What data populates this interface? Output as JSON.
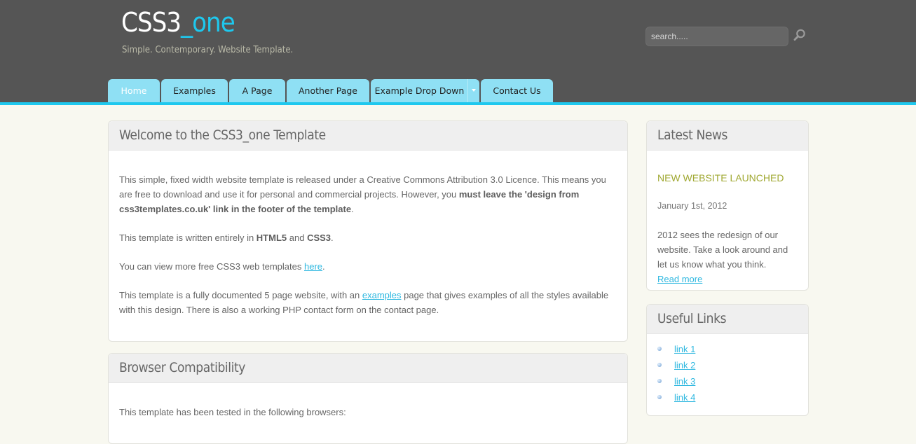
{
  "header": {
    "logo_part1": "CSS3",
    "logo_part2": "_one",
    "tagline": "Simple. Contemporary. Website Template.",
    "search_placeholder": "search.....",
    "search_icon": "magnifier-icon"
  },
  "menu": {
    "items": [
      {
        "label": "Home",
        "active": true
      },
      {
        "label": "Examples"
      },
      {
        "label": "A Page"
      },
      {
        "label": "Another Page"
      },
      {
        "label": "Example Drop Down",
        "has_dropdown": true
      },
      {
        "label": "Contact Us"
      }
    ]
  },
  "welcome": {
    "title": "Welcome to the CSS3_one Template",
    "p1_text": "This simple, fixed width website template is released under a Creative Commons Attribution 3.0 Licence. This means you are free to download and use it for personal and commercial projects. However, you ",
    "p1_bold": "must leave the 'design from css3templates.co.uk' link in the footer of the template",
    "p1_end": ".",
    "p2_text": "This template is written entirely in ",
    "p2_bold1": "HTML5",
    "p2_and": " and ",
    "p2_bold2": "CSS3",
    "p2_end": ".",
    "p3_text": "You can view more free CSS3 web templates ",
    "p3_link": "here",
    "p3_end": ".",
    "p4_text": "This template is a fully documented 5 page website, with an ",
    "p4_link": "examples",
    "p4_end": " page that gives examples of all the styles available with this design. There is also a working PHP contact form on the contact page."
  },
  "browser": {
    "title": "Browser Compatibility",
    "text": "This template has been tested in the following browsers:"
  },
  "news": {
    "title": "Latest News",
    "item_title": "NEW WEBSITE LAUNCHED",
    "item_date": "January 1st, 2012",
    "item_text": "2012 sees the redesign of our website. Take a look around and let us know what you think.",
    "read_more": "Read more"
  },
  "useful_links": {
    "title": "Useful Links",
    "links": [
      "link 1",
      "link 2",
      "link 3",
      "link 4"
    ]
  },
  "colors": {
    "accent": "#1ec8ee",
    "header_bg": "#555555",
    "tab_bg": "#8fe0f4",
    "news_title": "#a0a832",
    "link": "#2fb8e0"
  }
}
